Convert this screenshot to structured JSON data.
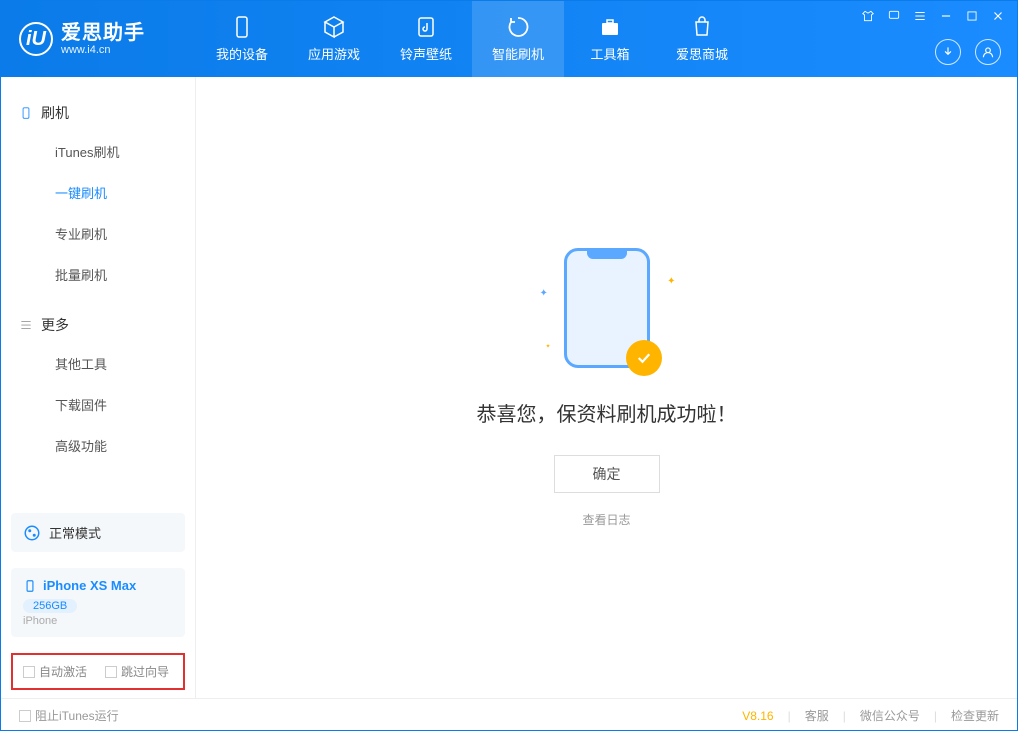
{
  "app": {
    "logo_letter": "iU",
    "title": "爱思助手",
    "subtitle": "www.i4.cn"
  },
  "tabs": [
    {
      "id": "device",
      "label": "我的设备"
    },
    {
      "id": "apps",
      "label": "应用游戏"
    },
    {
      "id": "ringtone",
      "label": "铃声壁纸"
    },
    {
      "id": "flash",
      "label": "智能刷机"
    },
    {
      "id": "toolbox",
      "label": "工具箱"
    },
    {
      "id": "store",
      "label": "爱思商城"
    }
  ],
  "sidebar": {
    "section1_title": "刷机",
    "section1_items": [
      {
        "label": "iTunes刷机"
      },
      {
        "label": "一键刷机"
      },
      {
        "label": "专业刷机"
      },
      {
        "label": "批量刷机"
      }
    ],
    "section2_title": "更多",
    "section2_items": [
      {
        "label": "其他工具"
      },
      {
        "label": "下载固件"
      },
      {
        "label": "高级功能"
      }
    ]
  },
  "device_panel": {
    "mode_label": "正常模式",
    "device_name": "iPhone XS Max",
    "storage": "256GB",
    "device_type": "iPhone"
  },
  "checkboxes": {
    "auto_activate": "自动激活",
    "skip_guide": "跳过向导"
  },
  "main": {
    "success_text": "恭喜您，保资料刷机成功啦！",
    "ok_button": "确定",
    "view_log": "查看日志"
  },
  "footer": {
    "block_itunes": "阻止iTunes运行",
    "version": "V8.16",
    "links": [
      "客服",
      "微信公众号",
      "检查更新"
    ]
  }
}
